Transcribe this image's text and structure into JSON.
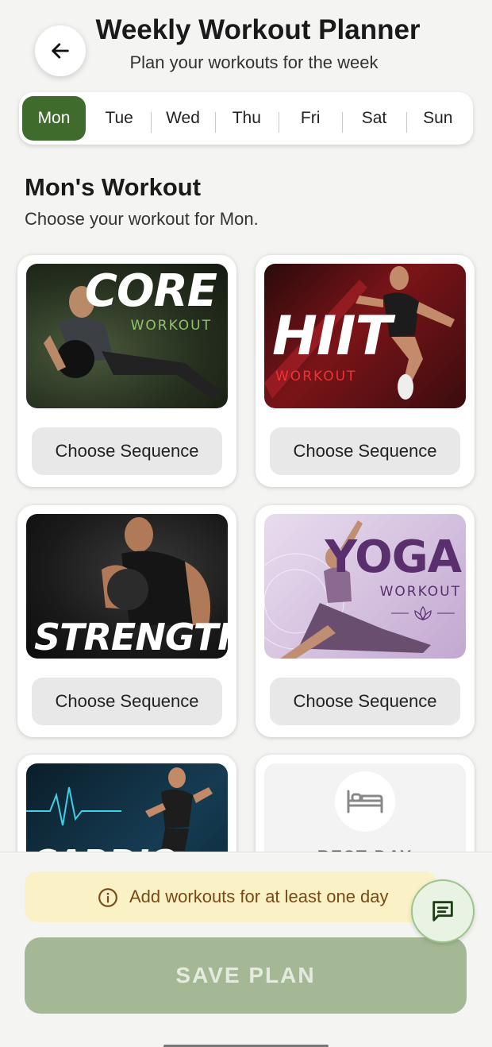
{
  "header": {
    "title": "Weekly Workout Planner",
    "subtitle": "Plan your workouts for the week",
    "back_icon": "arrow-left-icon"
  },
  "days": [
    {
      "label": "Mon",
      "active": true
    },
    {
      "label": "Tue",
      "active": false
    },
    {
      "label": "Wed",
      "active": false
    },
    {
      "label": "Thu",
      "active": false
    },
    {
      "label": "Fri",
      "active": false
    },
    {
      "label": "Sat",
      "active": false
    },
    {
      "label": "Sun",
      "active": false
    }
  ],
  "section": {
    "title": "Mon's Workout",
    "subtitle": "Choose your workout for Mon."
  },
  "workouts": [
    {
      "name": "CORE",
      "tag": "WORKOUT",
      "button": "Choose Sequence"
    },
    {
      "name": "HIIT",
      "tag": "WORKOUT",
      "button": "Choose Sequence"
    },
    {
      "name": "STRENGTH",
      "button": "Choose Sequence"
    },
    {
      "name": "YOGA",
      "tag": "WORKOUT",
      "button": "Choose Sequence"
    },
    {
      "name": "CARDIO"
    },
    {
      "name": "REST DAY",
      "icon": "bed-icon"
    }
  ],
  "footer": {
    "notice": "Add workouts for at least one day",
    "notice_icon": "info-icon",
    "save_label": "SAVE PLAN",
    "chat_icon": "chat-icon"
  },
  "colors": {
    "accent": "#3f6b2d",
    "save_disabled": "#a5b896",
    "notice_bg": "#fbf1c7"
  }
}
